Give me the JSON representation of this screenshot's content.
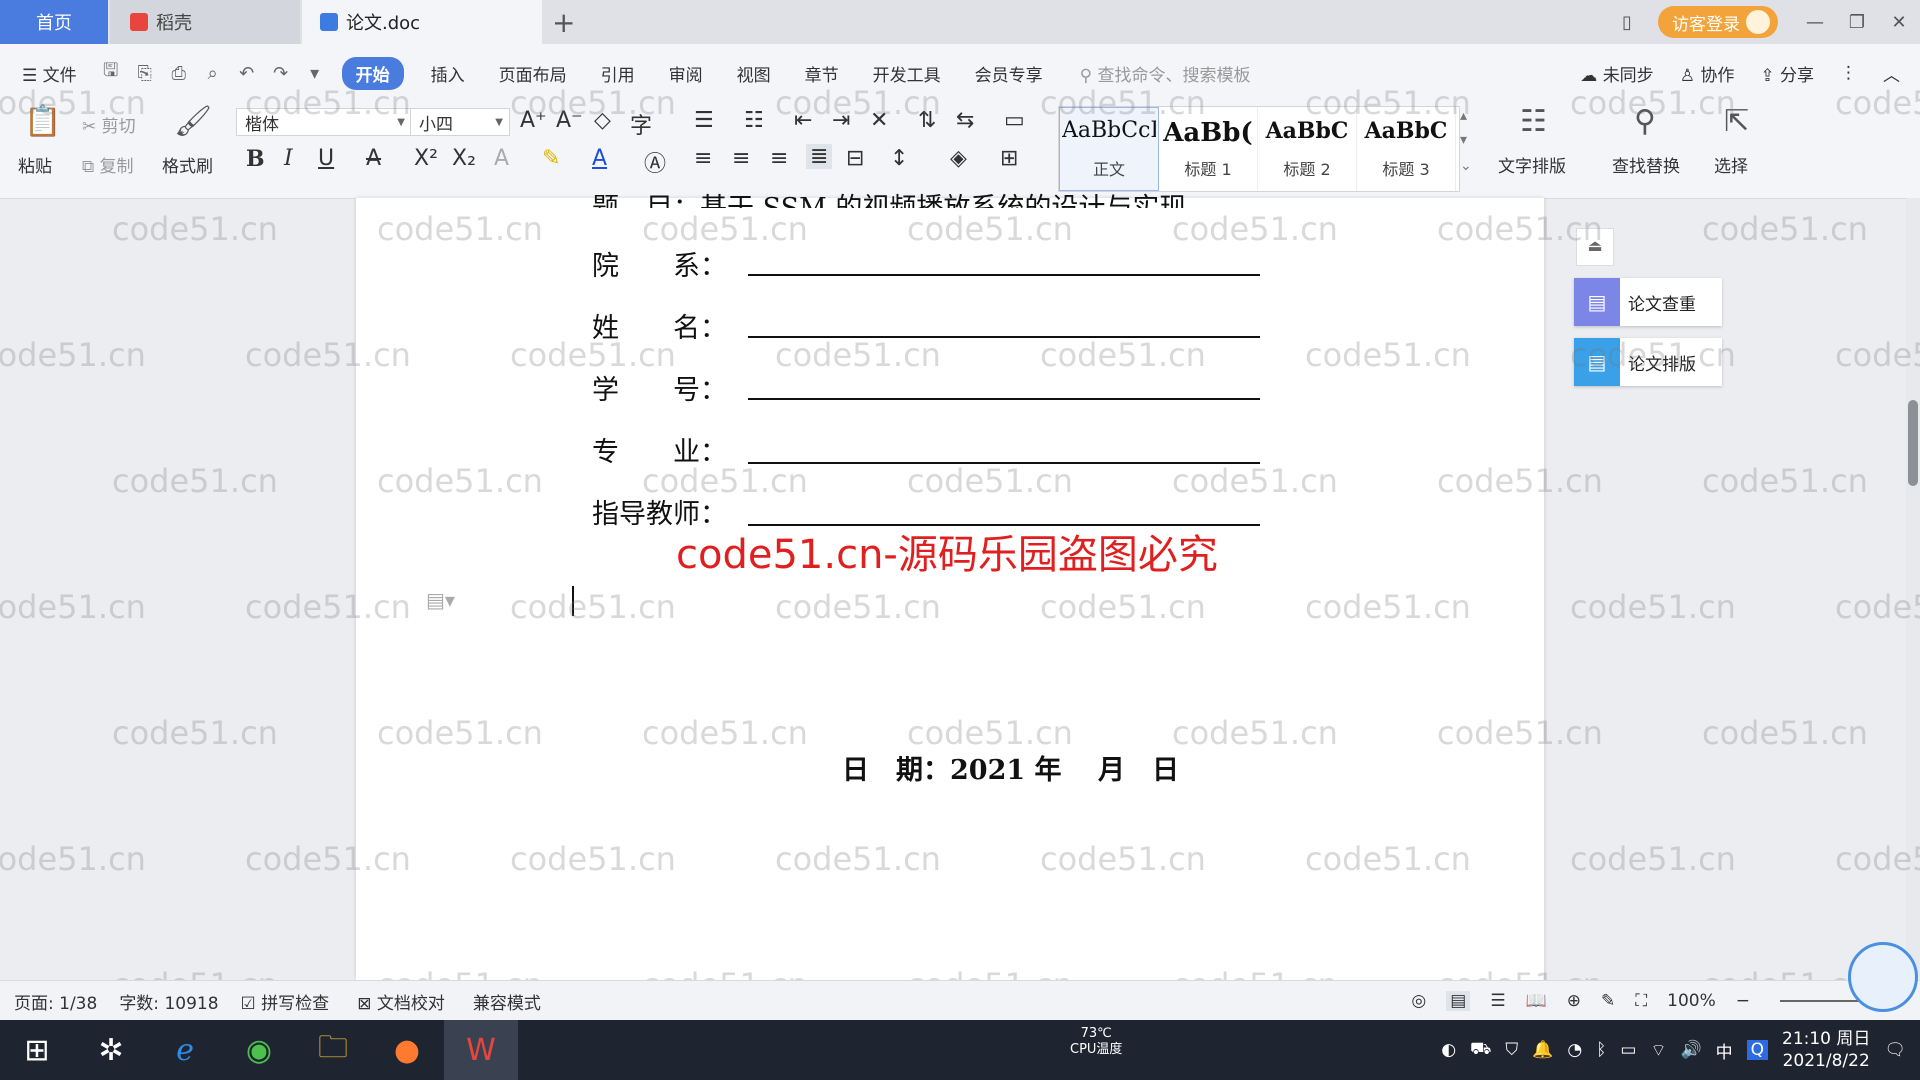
{
  "tabs": {
    "home": "首页",
    "docer": "稻壳",
    "doc": "论文.doc",
    "add": "+"
  },
  "titlebar": {
    "visitor_login": "访客登录",
    "minimize": "—",
    "restore": "❐",
    "close": "✕",
    "layout_icon": "▯"
  },
  "menu": {
    "file": "文件",
    "items": [
      "开始",
      "插入",
      "页面布局",
      "引用",
      "审阅",
      "视图",
      "章节",
      "开发工具",
      "会员专享"
    ],
    "search_placeholder": "查找命令、搜索模板",
    "unsynced": "未同步",
    "collab": "协作",
    "share": "分享"
  },
  "ribbon": {
    "paste": "粘贴",
    "cut": "剪切",
    "copy": "复制",
    "format_painter": "格式刷",
    "font_name": "楷体",
    "font_size": "小四",
    "styles": [
      {
        "preview": "AaBbCcI",
        "label": "正文"
      },
      {
        "preview": "AaBb(",
        "label": "标题 1"
      },
      {
        "preview": "AaBbC",
        "label": "标题 2"
      },
      {
        "preview": "AaBbC",
        "label": "标题 3"
      }
    ],
    "text_layout": "文字排版",
    "find_replace": "查找替换",
    "select": "选择"
  },
  "document": {
    "title_label": "题　目：",
    "title_value": "基于 SSM 的视频播放系统的设计与实现",
    "fields": [
      {
        "label": "院　　系："
      },
      {
        "label": "姓　　名："
      },
      {
        "label": "学　　号："
      },
      {
        "label": "专　　业："
      },
      {
        "label": "指导教师："
      }
    ],
    "date": "日　期：2021 年　 月　日",
    "watermark_main": "code51.cn-源码乐园盗图必究",
    "watermark_tile": "code51.cn"
  },
  "side_panel": {
    "plagiarism": "论文查重",
    "formatting": "论文排版"
  },
  "statusbar": {
    "page": "页面: 1/38",
    "words": "字数: 10918",
    "spell": "拼写检查",
    "proof": "文档校对",
    "compat": "兼容模式",
    "zoom": "100%"
  },
  "taskbar": {
    "cpu_temp": "73℃",
    "cpu_label": "CPU温度",
    "ime": "中",
    "time": "21:10 周日",
    "date": "2021/8/22"
  },
  "colors": {
    "accent": "#4a7bde",
    "visitor": "#f2a33a",
    "watermark_red": "#e02020",
    "taskbar": "#1e2531"
  }
}
